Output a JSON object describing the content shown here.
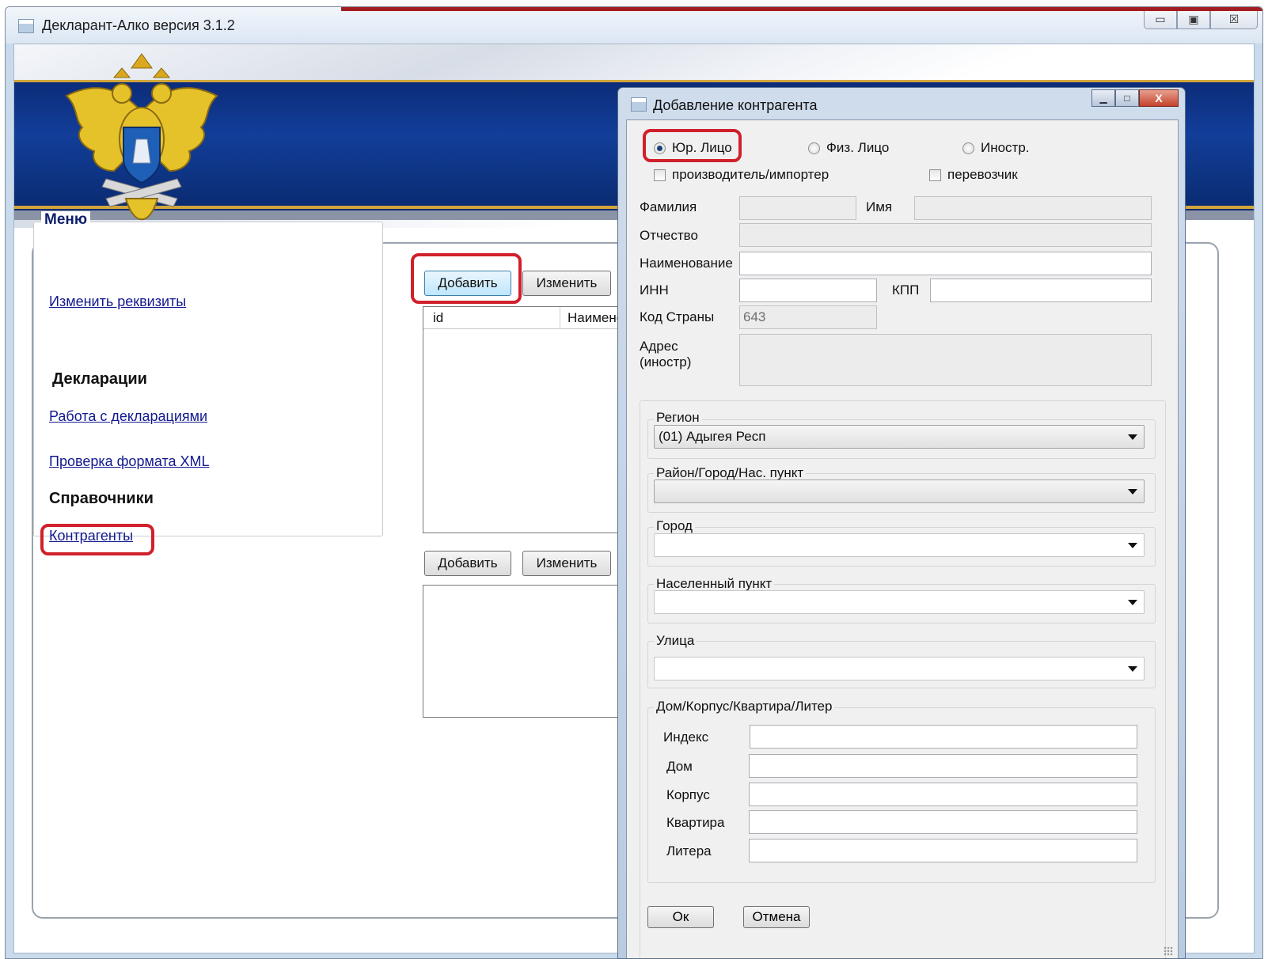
{
  "app": {
    "title": "Декларант-Алко версия 3.1.2",
    "window_controls": {
      "minimize": "▭",
      "maximize": "▣",
      "close": "☒"
    }
  },
  "menu": {
    "title": "Меню",
    "edit_requisites": "Изменить реквизиты",
    "declarations_heading": "Декларации",
    "work_with_declarations": "Работа с декларациями",
    "check_xml": "Проверка формата XML",
    "references_heading": "Справочники",
    "counterparties": "Контрагенты"
  },
  "main": {
    "add_button": "Добавить",
    "edit_button": "Изменить",
    "grid_columns": [
      "id",
      "Наимено"
    ],
    "add_button_2": "Добавить",
    "edit_button_2": "Изменить"
  },
  "dialog": {
    "title": "Добавление контрагента",
    "controls": {
      "minimize": "▁",
      "maximize": "□",
      "close": "X"
    },
    "radio_legal": "Юр. Лицо",
    "radio_individual": "Физ. Лицо",
    "radio_foreign": "Иностр.",
    "check_producer": "производитель/импортер",
    "check_carrier": "перевозчик",
    "label_surname": "Фамилия",
    "label_name": "Имя",
    "label_patronymic": "Отчество",
    "label_title": "Наименование",
    "label_inn": "ИНН",
    "label_kpp": "КПП",
    "label_country_code": "Код Страны",
    "country_code_value": "643",
    "label_address_line1": "Адрес",
    "label_address_line2": "(иностр)",
    "group_region": "Регион",
    "region_value": "(01) Адыгея Респ",
    "group_district": "Район/Город/Нас. пункт",
    "group_city": "Город",
    "group_settlement": "Населенный пункт",
    "group_street": "Улица",
    "group_house": "Дом/Корпус/Квартира/Литер",
    "label_index": "Индекс",
    "label_house": "Дом",
    "label_building": "Корпус",
    "label_apartment": "Квартира",
    "label_litera": "Литера",
    "ok_button": "Ок",
    "cancel_button": "Отмена"
  },
  "colors": {
    "highlight": "#d0202b",
    "link": "#12198f",
    "banner_blue": "#123e99",
    "banner_gold": "#d2a63a"
  }
}
